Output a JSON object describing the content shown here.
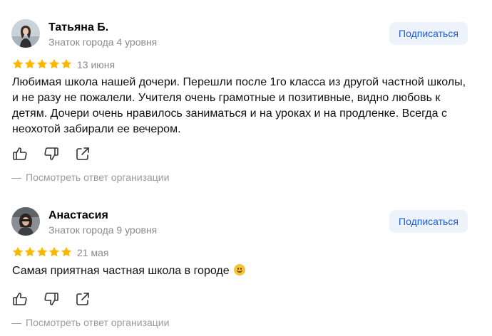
{
  "reviews": [
    {
      "author": "Татьяна Б.",
      "level": "Знаток города 4 уровня",
      "subscribe_label": "Подписаться",
      "rating": 5,
      "date": "13 июня",
      "text": "Любимая школа нашей дочери. Перешли после 1го класса из другой частной школы, и не разу не пожалели. Учителя очень грамотные и позитивные, видно любовь к детям. Дочери очень нравилось заниматься и на уроках и на продленке. Всегда с неохотой забирали ее вечером.",
      "org_reply_dash": "—",
      "org_reply_label": "Посмотреть ответ организации",
      "actions": [
        "like-icon",
        "dislike-icon",
        "share-icon"
      ]
    },
    {
      "author": "Анастасия",
      "level": "Знаток города 9 уровня",
      "subscribe_label": "Подписаться",
      "rating": 5,
      "date": "21 мая",
      "text": "Самая приятная частная школа в городе",
      "text_emoji": "smiling-face-emoji",
      "org_reply_dash": "—",
      "org_reply_label": "Посмотреть ответ организации",
      "actions": [
        "like-icon",
        "dislike-icon",
        "share-icon"
      ]
    }
  ],
  "colors": {
    "star": "#fcb800",
    "subscribe_bg": "#edf2fb",
    "subscribe_text": "#1a5fd8",
    "muted_text": "#8a8a8a"
  }
}
